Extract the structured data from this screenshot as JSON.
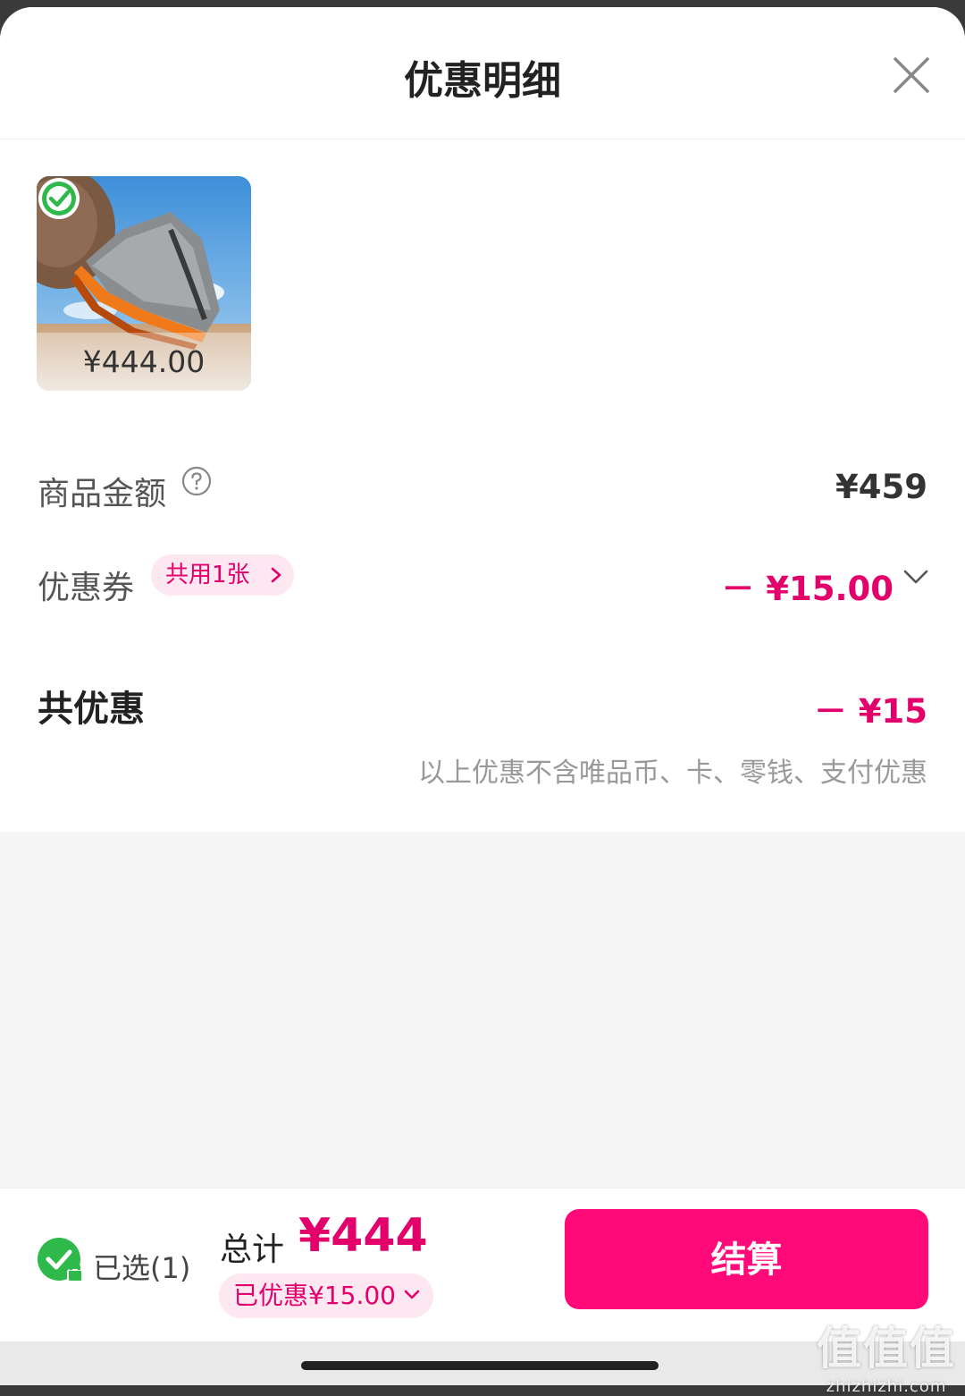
{
  "header": {
    "title": "优惠明细",
    "close_icon": "close-icon"
  },
  "product": {
    "price": "¥444.00",
    "image": "trail-running-shoe",
    "selected": true
  },
  "rows": {
    "goods_amount": {
      "label": "商品金额",
      "value": "¥459",
      "help_icon": "question-circle-icon"
    },
    "coupon": {
      "label": "优惠券",
      "pill": "共用1张",
      "value": "－ ¥15.00"
    },
    "total_discount": {
      "label": "共优惠",
      "value": "－ ¥15"
    },
    "note": "以上优惠不含唯品币、卡、零钱、支付优惠"
  },
  "footer": {
    "selected_label": "已选(1)",
    "sum_label": "总计",
    "sum_value": "¥444",
    "saved_label": "已优惠¥15.00",
    "checkout_label": "结算"
  },
  "watermark": {
    "big": "值值值",
    "small": "zhizhizhi.com"
  },
  "colors": {
    "accent": "#ff0a78",
    "accent_text": "#e4006b",
    "pill_bg": "#fde7f0",
    "check_green": "#2fb94a"
  }
}
